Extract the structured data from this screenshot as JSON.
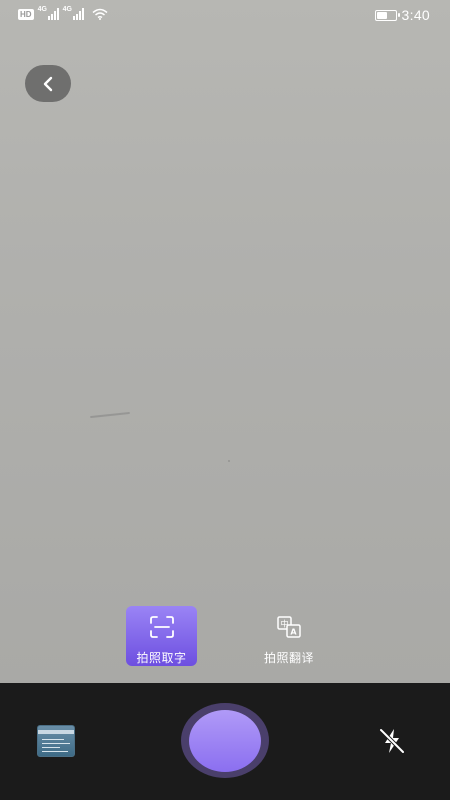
{
  "status_bar": {
    "time": "3:40",
    "hd_badge": "HD",
    "network_1": "4G",
    "network_2": "4G",
    "battery_level": 0.6,
    "icons": [
      "hd-icon",
      "signal-icon",
      "signal-icon",
      "wifi-icon",
      "battery-icon"
    ]
  },
  "navigation": {
    "back_icon": "chevron-left-icon"
  },
  "modes": {
    "items": [
      {
        "label": "拍照取字",
        "icon": "scan-text-icon",
        "active": true
      },
      {
        "label": "拍照翻译",
        "icon": "translate-icon",
        "active": false
      }
    ]
  },
  "bottom_bar": {
    "gallery_icon": "gallery-thumbnail",
    "shutter_icon": "shutter-button",
    "flash_icon": "flash-off-icon"
  },
  "colors": {
    "accent_top": "#9a84f5",
    "accent_bottom": "#6d4fe0",
    "shutter": "#8b6ff0",
    "bottom_bar": "#1b1b1b"
  }
}
